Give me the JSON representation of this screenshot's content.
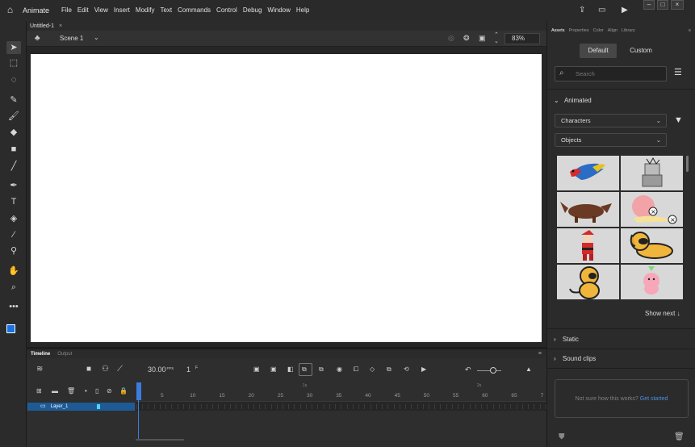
{
  "app": {
    "name": "Animate",
    "menus": [
      "File",
      "Edit",
      "View",
      "Insert",
      "Modify",
      "Text",
      "Commands",
      "Control",
      "Debug",
      "Window",
      "Help"
    ]
  },
  "document": {
    "tab_title": "Untitled-1",
    "scene": "Scene 1",
    "zoom": "83%"
  },
  "timeline": {
    "tabs": [
      "Timeline",
      "Output"
    ],
    "fps": "30.00",
    "fps_unit": "FPS",
    "frame": "1",
    "frame_unit": "F",
    "seconds_markers": [
      "1s",
      "2s"
    ],
    "ruler_ticks": [
      "5",
      "10",
      "15",
      "20",
      "25",
      "30",
      "35",
      "40",
      "45",
      "50",
      "55",
      "60",
      "65",
      "7"
    ],
    "layers": [
      {
        "name": "Layer_1"
      }
    ]
  },
  "panel": {
    "tabs": [
      "Assets",
      "Properties",
      "Color",
      "Align",
      "Library"
    ],
    "active_tab": "Assets",
    "segments": [
      "Default",
      "Custom"
    ],
    "search_placeholder": "Search",
    "sections": {
      "animated": "Animated",
      "static": "Static",
      "sound": "Sound clips"
    },
    "category_filter": "Characters",
    "type_filter": "Objects",
    "show_next": "Show next ↓",
    "help_text": "Not sure how this works?",
    "help_link": "Get started"
  },
  "colors": {
    "accent": "#3b7ddd",
    "layer_selected": "#1e5b96",
    "stage": "#ffffff",
    "fill_color": "#1473e6"
  }
}
